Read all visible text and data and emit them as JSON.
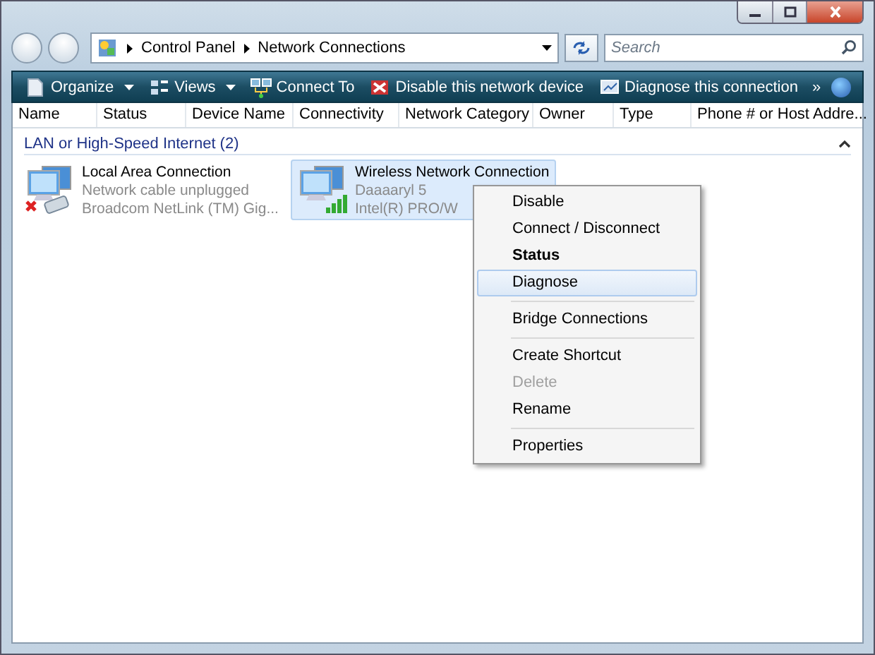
{
  "address": {
    "crumbs": [
      "Control Panel",
      "Network Connections"
    ],
    "search_placeholder": "Search"
  },
  "toolbar": {
    "items": [
      {
        "label": "Organize",
        "dropdown": true
      },
      {
        "label": "Views",
        "dropdown": true
      },
      {
        "label": "Connect To",
        "dropdown": false
      },
      {
        "label": "Disable this network device",
        "dropdown": false
      },
      {
        "label": "Diagnose this connection",
        "dropdown": false
      }
    ],
    "more": "»"
  },
  "columns": [
    "Name",
    "Status",
    "Device Name",
    "Connectivity",
    "Network Category",
    "Owner",
    "Type",
    "Phone # or Host Addre..."
  ],
  "group": {
    "title": "LAN or High-Speed Internet (2)",
    "expanded": true
  },
  "connections": [
    {
      "name": "Local Area Connection",
      "status": "Network cable unplugged",
      "device": "Broadcom NetLink (TM) Gig...",
      "kind": "unplugged",
      "selected": false
    },
    {
      "name": "Wireless Network Connection",
      "status": "Daaaaryl  5",
      "device": "Intel(R) PRO/W",
      "kind": "wireless",
      "selected": true
    }
  ],
  "context_menu": [
    [
      {
        "label": "Disable",
        "default": false,
        "selected": false,
        "disabled": false
      },
      {
        "label": "Connect / Disconnect",
        "default": false,
        "selected": false,
        "disabled": false
      },
      {
        "label": "Status",
        "default": true,
        "selected": false,
        "disabled": false
      },
      {
        "label": "Diagnose",
        "default": false,
        "selected": true,
        "disabled": false
      }
    ],
    [
      {
        "label": "Bridge Connections",
        "default": false,
        "selected": false,
        "disabled": false
      }
    ],
    [
      {
        "label": "Create Shortcut",
        "default": false,
        "selected": false,
        "disabled": false
      },
      {
        "label": "Delete",
        "default": false,
        "selected": false,
        "disabled": true
      },
      {
        "label": "Rename",
        "default": false,
        "selected": false,
        "disabled": false
      }
    ],
    [
      {
        "label": "Properties",
        "default": false,
        "selected": false,
        "disabled": false
      }
    ]
  ]
}
